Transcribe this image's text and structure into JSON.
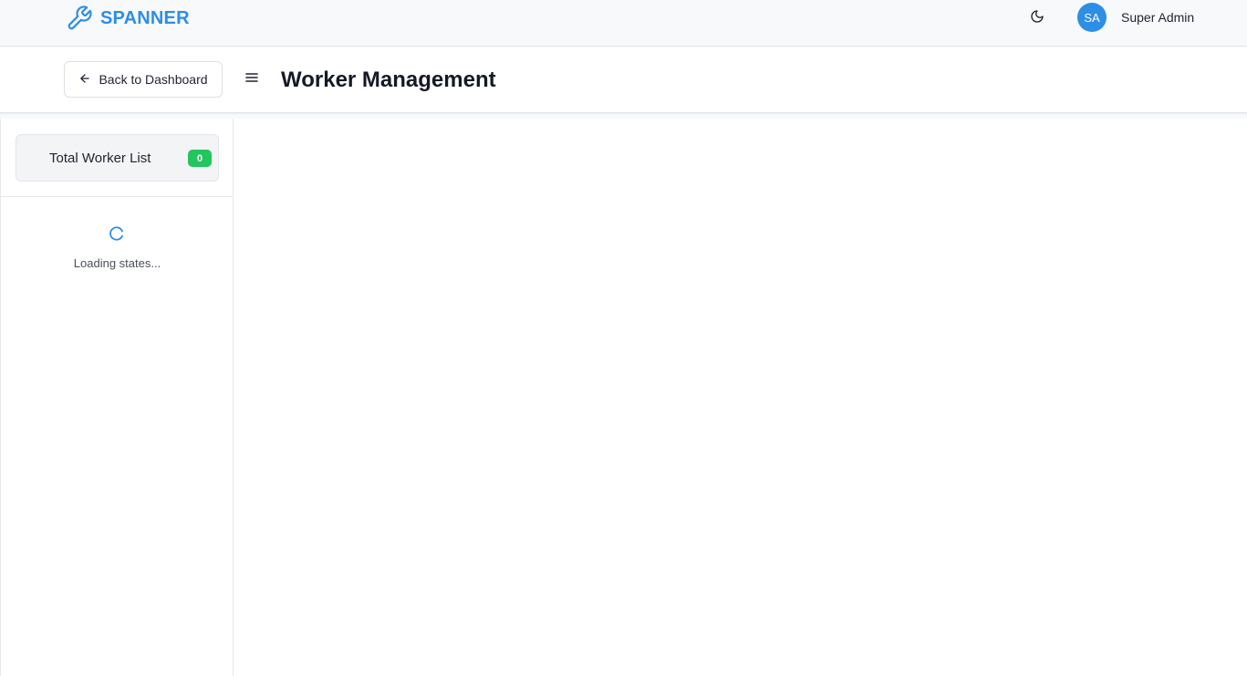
{
  "header": {
    "brand_name": "SPANNER",
    "brand_icon": "wrench-icon",
    "theme_icon": "moon-icon",
    "user": {
      "initials": "SA",
      "name": "Super Admin"
    },
    "colors": {
      "brand": "#2d8ee6"
    }
  },
  "subheader": {
    "back_label": "Back to Dashboard",
    "back_icon": "arrow-left-icon",
    "menu_icon": "hamburger-icon",
    "title": "Worker Management"
  },
  "sidebar": {
    "total_label": "Total Worker List",
    "total_count": "0",
    "loading_text": "Loading states...",
    "colors": {
      "badge": "#22c55e",
      "spinner": "#2d8ee6"
    }
  }
}
